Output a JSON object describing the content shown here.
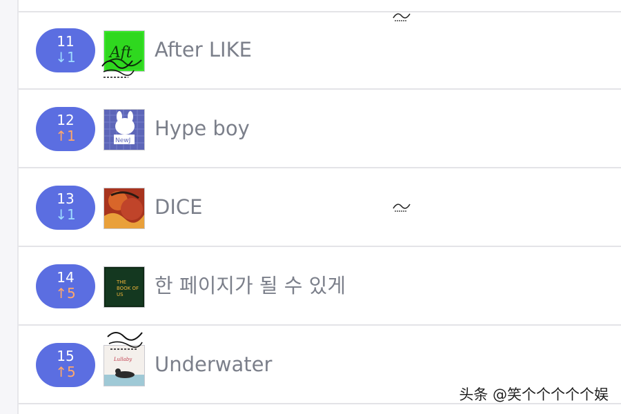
{
  "rows": [
    {
      "rank": "11",
      "change": "↓1",
      "direction": "down",
      "title": "After LIKE",
      "cover": "after-like-cover"
    },
    {
      "rank": "12",
      "change": "↑1",
      "direction": "up",
      "title": "Hype boy",
      "cover": "hype-boy-cover"
    },
    {
      "rank": "13",
      "change": "↓1",
      "direction": "down",
      "title": "DICE",
      "cover": "dice-cover"
    },
    {
      "rank": "14",
      "change": "↑5",
      "direction": "up",
      "title": "한 페이지가 될 수 있게",
      "cover": "time-of-our-life-cover"
    },
    {
      "rank": "15",
      "change": "↑5",
      "direction": "up",
      "title": "Underwater",
      "cover": "underwater-cover"
    }
  ],
  "watermark": "头条 @笑个个个个个娱",
  "colors": {
    "pill": "#5b6ee1",
    "change_up": "#ffa86a",
    "change_down": "#9fdcff",
    "title": "#7b7f8a"
  }
}
